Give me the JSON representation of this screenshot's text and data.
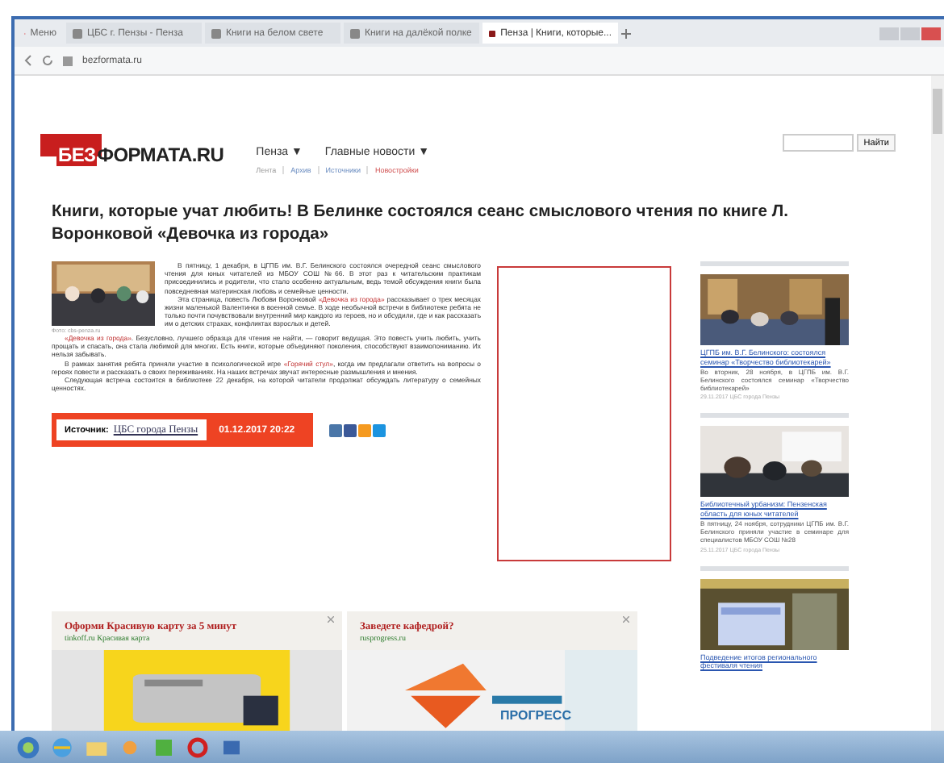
{
  "browser": {
    "tabs": [
      {
        "label": "Меню",
        "selected": false
      },
      {
        "label": "ЦБС г. Пензы - Пенза",
        "selected": false
      },
      {
        "label": "Книги на белом свете",
        "selected": false
      },
      {
        "label": "Книги на далёкой полке",
        "selected": false
      },
      {
        "label": "Пенза | Книги, которые...",
        "selected": true
      }
    ],
    "address": "bezformata.ru"
  },
  "site": {
    "logo_lead": "БЕЗ",
    "logo_rest": "ФОРМАТА.RU",
    "nav": [
      "Пенза ▼",
      "Главные новости ▼"
    ],
    "subnav": [
      {
        "label": "Лента",
        "kind": "plain"
      },
      {
        "label": "Архив",
        "kind": "link"
      },
      {
        "label": "Источники",
        "kind": "link"
      },
      {
        "label": "Новостройки",
        "kind": "accent"
      }
    ],
    "search": {
      "button": "Найти"
    }
  },
  "article": {
    "title": "Книги, которые учат любить! В Белинке состоялся сеанс смыслового чтения по книге Л. Воронковой «Девочка из города»",
    "photo_caption": "Фото: cbs-penza.ru",
    "paragraphs": [
      "В пятницу, 1 декабря, в ЦГПБ им. В.Г. Белинского состоялся очередной сеанс смыслового чтения для юных читателей из МБОУ СОШ №66. В этот раз к читательским практикам присоединились и родители, что стало особенно актуальным, ведь темой обсуждения книги была повседневная материнская любовь и семейные ценности.",
      "Эта страница, повесть Любови Воронковой *«Девочка из города»* рассказывает о трех месяцах жизни маленькой Валентинки в военной семье. В ходе необычной встречи в библиотеке ребята не только почти почувствовали внутренний мир каждого из героев, но и обсудили, где и как рассказать им о детских страхах, конфликтах взрослых и детей.",
      "*«Девочка из города»*. Безусловно, лучшего образца для чтения не найти, — говорит ведущая. Это повесть учить любить, учить прощать и спасать, она стала любимой для многих. Есть книги, которые объединяют поколения, способствуют взаимопониманию. Их нельзя забывать.",
      "В рамках занятия ребята приняли участие в психологической игре *«Горячий стул»*, когда им предлагали ответить на вопросы о героях повести и рассказать о своих переживаниях. На наших встречах звучат интересные размышления и мнения.",
      "Следующая встреча состоится в библиотеке 22 декабря, на которой читатели продолжат обсуждать литературу о семейных ценностях."
    ],
    "source_label": "Источник:",
    "source": "ЦБС города Пензы",
    "date": "01.12.2017 20:22"
  },
  "ads": [
    {
      "title": "Оформи Красивую карту за 5 минут",
      "sub": "tinkoff.ru Красивая карта",
      "kind": "picture"
    },
    {
      "title": "Заведете кафедрой?",
      "sub": "rusprogress.ru",
      "kind": "picture",
      "brand": "ПРОГРЕСС"
    }
  ],
  "sidebar": [
    {
      "title": "ЦГПБ им. В.Г. Белинского: состоялся семинар «Творчество библиотекарей»",
      "text": "Во вторник, 28 ноября, в ЦГПБ им. В.Г. Белинского состоялся семинар «Творчество библиотекарей»",
      "meta": "29.11.2017 ЦБС города Пензы",
      "kind": "picture"
    },
    {
      "title": "Библиотечный урбанизм: Пензенская область для юных читателей",
      "text": "В пятницу, 24 ноября, сотрудники ЦГПБ им. В.Г. Белинского приняли участие в семинаре для специалистов МБОУ СОШ №28",
      "meta": "25.11.2017 ЦБС города Пензы",
      "kind": "picture"
    },
    {
      "title": "Подведение итогов регионального фестиваля чтения",
      "kind": "picture"
    }
  ]
}
